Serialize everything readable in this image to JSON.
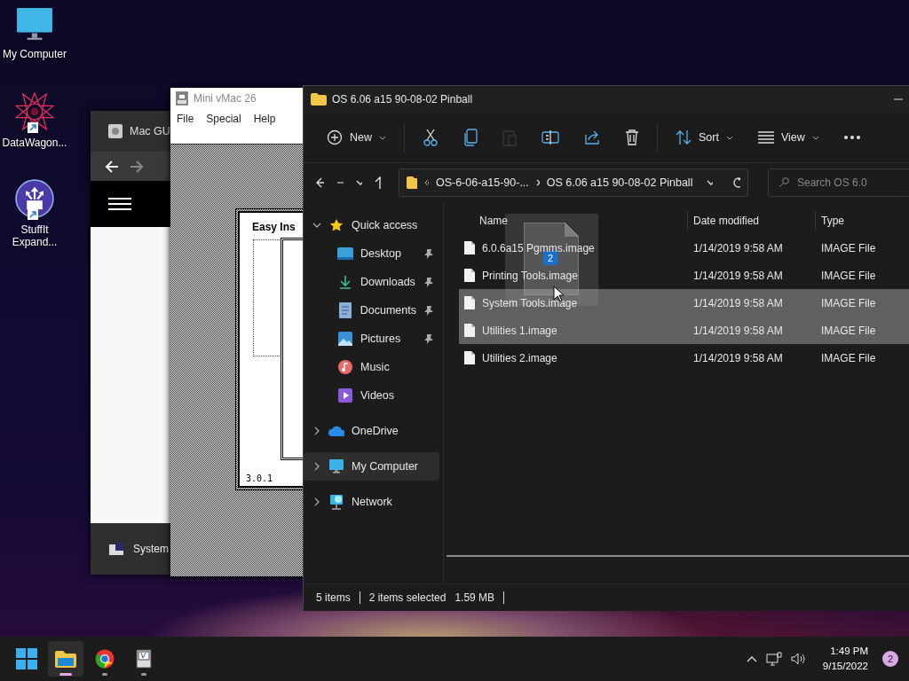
{
  "desktop_icons": [
    {
      "label": "My Computer",
      "kind": "computer",
      "shortcut": false
    },
    {
      "label": "DataWagon...",
      "kind": "mandala",
      "shortcut": true
    },
    {
      "label": "StuffIt Expand...",
      "kind": "stuffit",
      "shortcut": true
    }
  ],
  "browser_window": {
    "title": "Mac GU",
    "footer_item": "System"
  },
  "vmac_window": {
    "title": "Mini vMac 26",
    "menu": [
      "File",
      "Special",
      "Help"
    ],
    "dialog_title": "Easy Ins",
    "version": "3.0.1"
  },
  "explorer": {
    "title": "OS 6.06 a15 90-08-02 Pinball",
    "toolbar": [
      {
        "kind": "new",
        "label": "New",
        "disabled": false
      },
      {
        "kind": "cut",
        "disabled": false
      },
      {
        "kind": "copy",
        "disabled": false
      },
      {
        "kind": "paste",
        "disabled": true
      },
      {
        "kind": "rename",
        "disabled": false
      },
      {
        "kind": "share",
        "disabled": false
      },
      {
        "kind": "delete",
        "disabled": false
      },
      {
        "kind": "sort",
        "label": "Sort",
        "disabled": false
      },
      {
        "kind": "view",
        "label": "View",
        "disabled": false
      },
      {
        "kind": "more",
        "disabled": false
      }
    ],
    "breadcrumbs": [
      "OS-6-06-a15-90-...",
      "OS 6.06 a15 90-08-02 Pinball"
    ],
    "search": {
      "placeholder": "Search OS 6.0"
    },
    "sidebar": [
      {
        "label": "Quick access",
        "kind": "star",
        "expanded": true,
        "selected": false,
        "children": [
          {
            "label": "Desktop",
            "kind": "desktop",
            "pinned": true,
            "selected": false
          },
          {
            "label": "Downloads",
            "kind": "download",
            "pinned": true,
            "selected": false
          },
          {
            "label": "Documents",
            "kind": "document",
            "pinned": true,
            "selected": false
          },
          {
            "label": "Pictures",
            "kind": "picture",
            "pinned": true,
            "selected": false
          },
          {
            "label": "Music",
            "kind": "music",
            "pinned": false,
            "selected": false
          },
          {
            "label": "Videos",
            "kind": "video",
            "pinned": false,
            "selected": false
          }
        ]
      },
      {
        "label": "OneDrive",
        "kind": "cloud",
        "expanded": false,
        "selected": false
      },
      {
        "label": "My Computer",
        "kind": "computer",
        "expanded": false,
        "selected": true
      },
      {
        "label": "Network",
        "kind": "network",
        "expanded": false,
        "selected": false
      }
    ],
    "columns": [
      "Name",
      "Date modified",
      "Type"
    ],
    "rows": [
      {
        "name": "6.0.6a15 Pgmms.image",
        "date": "1/14/2019 9:58 AM",
        "type": "IMAGE File",
        "selected": false
      },
      {
        "name": "Printing Tools.image",
        "date": "1/14/2019 9:58 AM",
        "type": "IMAGE File",
        "selected": false
      },
      {
        "name": "System Tools.image",
        "date": "1/14/2019 9:58 AM",
        "type": "IMAGE File",
        "selected": true
      },
      {
        "name": "Utilities 1.image",
        "date": "1/14/2019 9:58 AM",
        "type": "IMAGE File",
        "selected": true
      },
      {
        "name": "Utilities 2.image",
        "date": "1/14/2019 9:58 AM",
        "type": "IMAGE File",
        "selected": false
      }
    ],
    "drag": {
      "count": "2"
    },
    "status": {
      "items": "5 items",
      "selected": "2 items selected",
      "size": "1.59 MB"
    }
  },
  "taskbar": {
    "apps": [
      {
        "kind": "explorer",
        "active": true
      },
      {
        "kind": "chrome",
        "active": false
      },
      {
        "kind": "vmac",
        "active": false
      }
    ],
    "time": "1:49 PM",
    "date": "9/15/2022",
    "notifications": "2"
  }
}
